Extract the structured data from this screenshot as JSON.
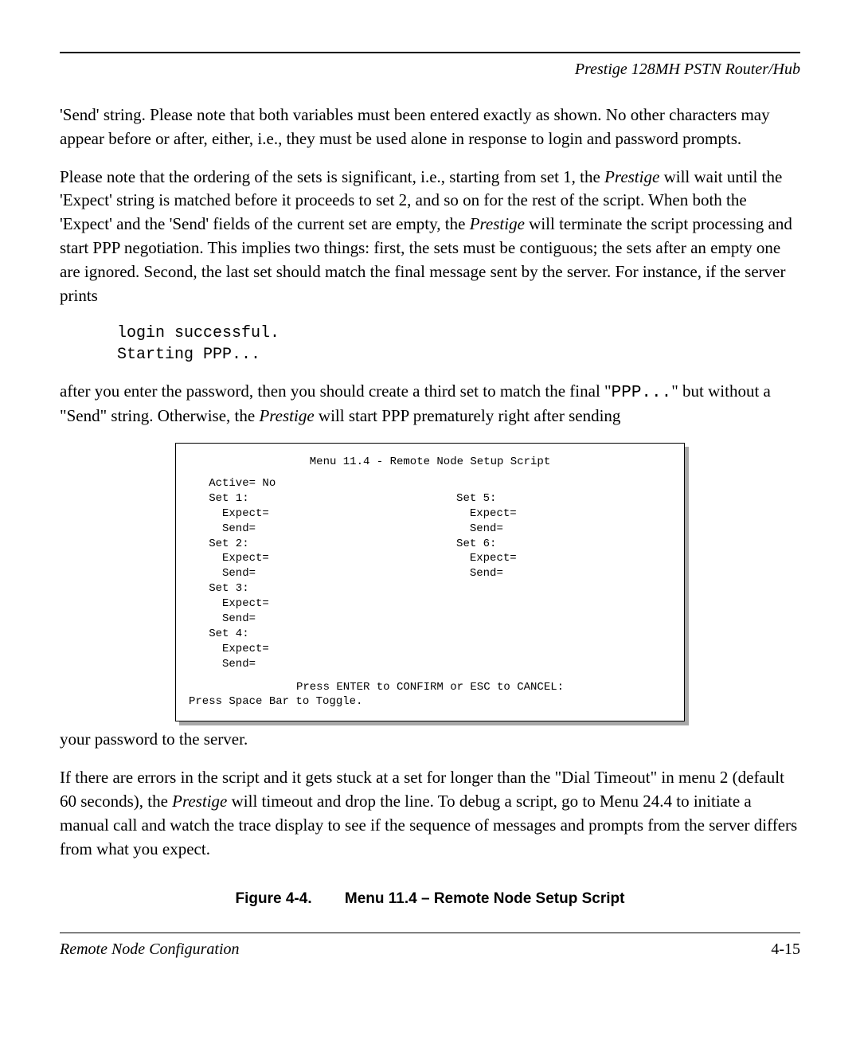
{
  "header": {
    "text": "Prestige 128MH  PSTN Router/Hub"
  },
  "paragraphs": {
    "p1": "'Send' string.  Please note that both variables must been entered exactly as shown.  No other characters may appear before or after, either, i.e., they must be used alone in response to login and password prompts.",
    "p2_pre": "Please note that the ordering of the sets is significant, i.e., starting from set 1, the ",
    "p2_em1": "Prestige",
    "p2_mid1": " will wait until the 'Expect' string is matched before it proceeds to set 2, and so on for the rest of the script.  When both the 'Expect' and the 'Send' fields of the current set are empty, the ",
    "p2_em2": "Prestige",
    "p2_mid2": " will terminate the script processing and start PPP negotiation.  This implies two things: first, the sets must be contiguous; the sets after an empty one are ignored.  Second, the last set should match the final message sent by the server.  For instance, if the server prints",
    "code_line1": "login successful.",
    "code_line2": "Starting PPP...",
    "p3_pre": "after you enter the password, then you should create a third set to match the final \"",
    "p3_mono": "PPP...",
    "p3_mid": "\" but without a \"Send\" string.  Otherwise, the ",
    "p3_em": "Prestige",
    "p3_post": " will start PPP prematurely right after sending",
    "p4": "your password to the server.",
    "p5_pre": "If there are errors in the script and it gets stuck at a set for longer than the \"Dial Timeout\" in menu 2 (default 60 seconds), the ",
    "p5_em": "Prestige",
    "p5_post": " will timeout and drop the line.  To debug a script, go to Menu 24.4 to initiate a manual call and watch the trace display to see if the sequence of messages and prompts from the server differs from what you expect."
  },
  "menu": {
    "title": "Menu 11.4 - Remote Node Setup Script",
    "active": "   Active= No",
    "blank": "",
    "row_set1": "   Set 1:                               Set 5:",
    "row_exp1": "     Expect=                              Expect=",
    "row_send1": "     Send=                                Send=",
    "row_set2": "   Set 2:                               Set 6:",
    "row_exp2": "     Expect=                              Expect=",
    "row_send2": "     Send=                                Send=",
    "row_set3": "   Set 3:",
    "row_exp3": "     Expect=",
    "row_send3": "     Send=",
    "row_set4": "   Set 4:",
    "row_exp4": "     Expect=",
    "row_send4": "     Send=",
    "footer": "Press ENTER to CONFIRM or ESC to CANCEL:",
    "footer2": "Press Space Bar to Toggle."
  },
  "figure": {
    "label": "Figure 4-4.",
    "title": "Menu 11.4 – Remote Node Setup Script"
  },
  "footer": {
    "left": "Remote Node Configuration",
    "right": "4-15"
  }
}
